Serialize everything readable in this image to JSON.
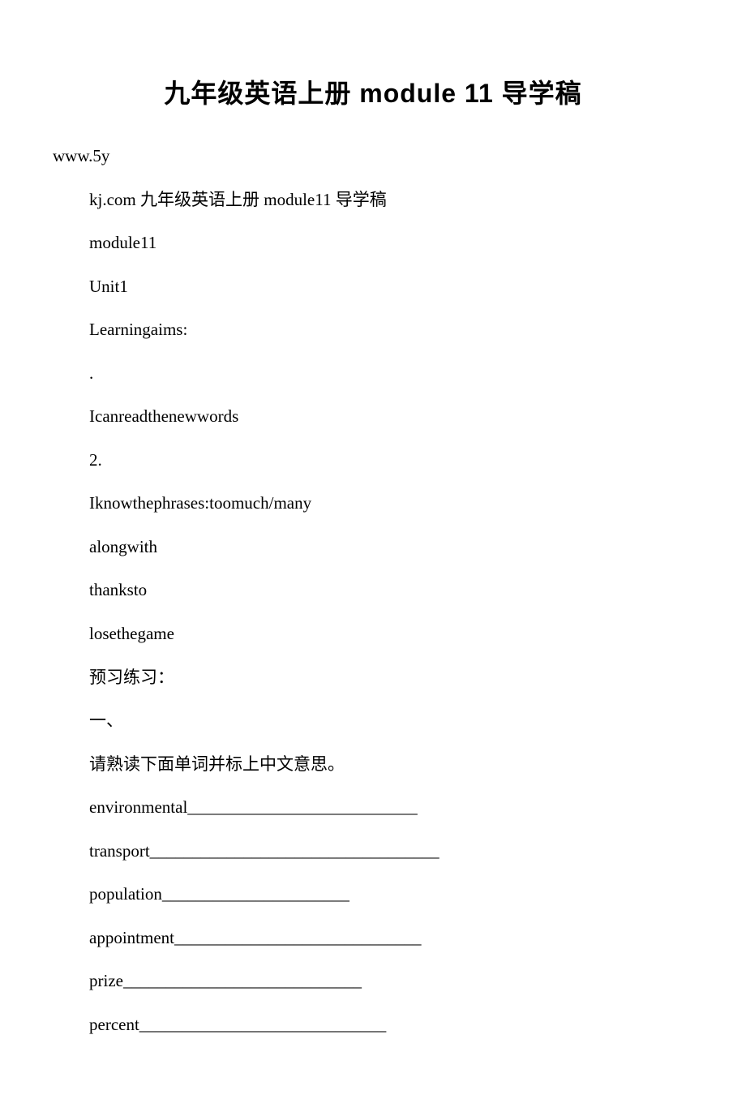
{
  "title": "九年级英语上册 module 11 导学稿",
  "lines": [
    "www.5y",
    "kj.com    九年级英语上册 module11 导学稿",
    "module11",
    "Unit1",
    "Learningaims:",
    ".",
    "Icanreadthenewwords",
    "2.",
    "Iknowthephrases:toomuch/many",
    "alongwith",
    "thanksto",
    "losethegame",
    "预习练习：",
    "一、",
    "请熟读下面单词并标上中文意思。",
    "environmental___________________________",
    "transport__________________________________",
    "population______________________",
    "appointment_____________________________",
    "prize____________________________",
    "percent_____________________________"
  ]
}
